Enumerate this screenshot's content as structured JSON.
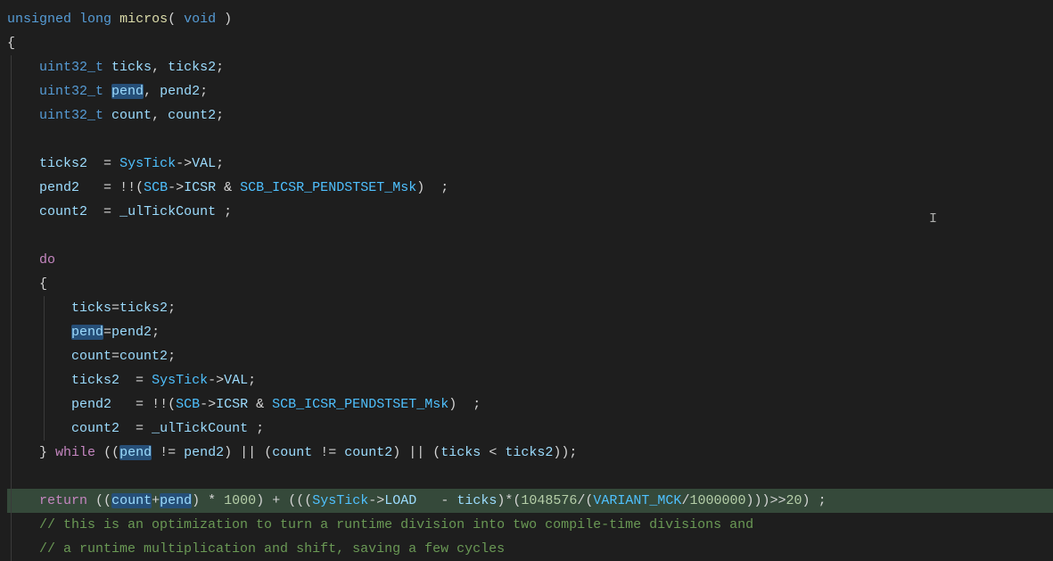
{
  "code": {
    "l1": {
      "t1": "unsigned",
      "t2": "long",
      "fn": "micros",
      "p1": "(",
      "t3": "void",
      "p2": ")"
    },
    "l2": {
      "brace": "{"
    },
    "l3": {
      "indent": "    ",
      "t": "uint32_t",
      "sp": " ",
      "v1": "ticks",
      "c": ",",
      "sp2": " ",
      "v2": "ticks2",
      "s": ";"
    },
    "l4": {
      "indent": "    ",
      "t": "uint32_t",
      "sp": " ",
      "v1h": "pend",
      "c": ",",
      "sp2": " ",
      "v2": "pend2",
      "s": ";"
    },
    "l5": {
      "indent": "    ",
      "t": "uint32_t",
      "sp": " ",
      "v1": "count",
      "c": ",",
      "sp2": " ",
      "v2": "count2",
      "s": ";"
    },
    "l6": {
      "indent": "    "
    },
    "l7": {
      "indent": "    ",
      "v1": "ticks2",
      "pad": "  ",
      "eq": "=",
      "sp": " ",
      "c1": "SysTick",
      "ar": "->",
      "p": "VAL",
      "s": ";"
    },
    "l8": {
      "indent": "    ",
      "v1": "pend2",
      "pad": "   ",
      "eq": "=",
      "sp": " ",
      "nn": "!!",
      "op": "(",
      "c1": "SCB",
      "ar": "->",
      "p": "ICSR",
      "amp": " & ",
      "c2": "SCB_ICSR_PENDSTSET_Msk",
      "cp": ")",
      "pad2": "  ",
      "s": ";"
    },
    "l9": {
      "indent": "    ",
      "v1": "count2",
      "pad": "  ",
      "eq": "=",
      "sp": " ",
      "v2": "_ulTickCount",
      "sp2": " ",
      "s": ";"
    },
    "l10": {
      "indent": "    "
    },
    "l11": {
      "indent": "    ",
      "kw": "do"
    },
    "l12": {
      "indent": "    ",
      "brace": "{"
    },
    "l13": {
      "indent": "        ",
      "v1": "ticks",
      "eq": "=",
      "v2": "ticks2",
      "s": ";"
    },
    "l14": {
      "indent": "        ",
      "v1h": "pend",
      "eq": "=",
      "v2": "pend2",
      "s": ";"
    },
    "l15": {
      "indent": "        ",
      "v1": "count",
      "eq": "=",
      "v2": "count2",
      "s": ";"
    },
    "l16": {
      "indent": "        ",
      "v1": "ticks2",
      "pad": "  ",
      "eq": "=",
      "sp": " ",
      "c1": "SysTick",
      "ar": "->",
      "p": "VAL",
      "s": ";"
    },
    "l17": {
      "indent": "        ",
      "v1": "pend2",
      "pad": "   ",
      "eq": "=",
      "sp": " ",
      "nn": "!!",
      "op": "(",
      "c1": "SCB",
      "ar": "->",
      "p": "ICSR",
      "amp": " & ",
      "c2": "SCB_ICSR_PENDSTSET_Msk",
      "cp": ")",
      "pad2": "  ",
      "s": ";"
    },
    "l18": {
      "indent": "        ",
      "v1": "count2",
      "pad": "  ",
      "eq": "=",
      "sp": " ",
      "v2": "_ulTickCount",
      "sp2": " ",
      "s": ";"
    },
    "l19": {
      "indent": "    ",
      "cb": "}",
      "sp": " ",
      "kw": "while",
      "sp2": " ",
      "op": "(",
      "op2": "(",
      "v1h": "pend",
      "ne": " != ",
      "v2": "pend2",
      "cp": ")",
      "or": " || ",
      "op3": "(",
      "v3": "count",
      "ne2": " != ",
      "v4": "count2",
      "cp2": ")",
      "or2": " || ",
      "op4": "(",
      "v5": "ticks",
      "lt": " < ",
      "v6": "ticks2",
      "cp3": ")",
      "cp4": ")",
      "s": ";"
    },
    "l20": {
      "indent": "    "
    },
    "l21": {
      "indent": "    ",
      "kw": "return",
      "sp": " ",
      "p1": "((",
      "v1h": "count",
      "plus": "+",
      "v2h": "pend",
      "cp1": ")",
      "sp2": " ",
      "mul": "*",
      "sp3": " ",
      "n1": "1000",
      "cp2": ")",
      "sp4": " ",
      "pl2": "+",
      "sp5": " ",
      "p3": "(((",
      "c1": "SysTick",
      "ar": "->",
      "p": "LOAD",
      "pad": "  ",
      "min": " - ",
      "v3": "ticks",
      "cp3": ")",
      "mul2": "*(",
      "n2": "1048576",
      "div": "/(",
      "c2": "VARIANT_MCK",
      "div2": "/",
      "n3": "1000000",
      "cp4": ")))",
      "shf": ">>",
      "n4": "20",
      "cp5": ")",
      "sp6": " ",
      "s": ";"
    },
    "l22": {
      "indent": "    ",
      "c": "// this is an optimization to turn a runtime division into two compile-time divisions and"
    },
    "l23": {
      "indent": "    ",
      "c": "// a runtime multiplication and shift, saving a few cycles"
    }
  }
}
